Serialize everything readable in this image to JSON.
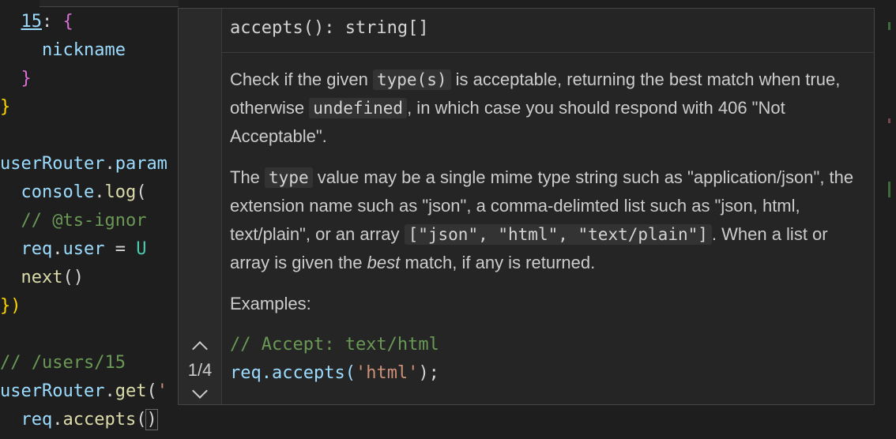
{
  "editor": {
    "lines": [
      {
        "parts": [
          [
            "  ",
            "plain"
          ],
          [
            "15",
            "ln-num"
          ],
          [
            ": ",
            "plain"
          ],
          [
            "{",
            "brace1"
          ]
        ]
      },
      {
        "parts": [
          [
            "    ",
            "plain"
          ],
          [
            "nickname",
            "var"
          ]
        ]
      },
      {
        "parts": [
          [
            "  ",
            "plain"
          ],
          [
            "}",
            "brace1"
          ]
        ]
      },
      {
        "parts": [
          [
            "}",
            "brace2"
          ]
        ]
      },
      {
        "parts": [
          [
            "",
            "plain"
          ]
        ]
      },
      {
        "parts": [
          [
            "userRouter",
            "var"
          ],
          [
            ".",
            "plain"
          ],
          [
            "param",
            "var"
          ]
        ]
      },
      {
        "parts": [
          [
            "  ",
            "plain"
          ],
          [
            "console",
            "var"
          ],
          [
            ".",
            "plain"
          ],
          [
            "log",
            "fn"
          ],
          [
            "(",
            "plain"
          ]
        ]
      },
      {
        "parts": [
          [
            "  ",
            "plain"
          ],
          [
            "// @ts-ignor",
            "cmt"
          ]
        ]
      },
      {
        "parts": [
          [
            "  ",
            "plain"
          ],
          [
            "req",
            "var"
          ],
          [
            ".",
            "plain"
          ],
          [
            "user",
            "var"
          ],
          [
            " = ",
            "plain"
          ],
          [
            "U",
            "cls"
          ]
        ]
      },
      {
        "parts": [
          [
            "  ",
            "plain"
          ],
          [
            "next",
            "fn"
          ],
          [
            "()",
            "plain"
          ]
        ]
      },
      {
        "parts": [
          [
            "}",
            "brace2"
          ],
          [
            ")",
            "brace2"
          ]
        ]
      },
      {
        "parts": [
          [
            "",
            "plain"
          ]
        ]
      },
      {
        "parts": [
          [
            "// /users/15",
            "cmt"
          ]
        ]
      },
      {
        "parts": [
          [
            "userRouter",
            "var"
          ],
          [
            ".",
            "plain"
          ],
          [
            "get",
            "fn"
          ],
          [
            "(",
            "plain"
          ],
          [
            "'",
            "str"
          ]
        ]
      },
      {
        "parts": [
          [
            "  ",
            "plain"
          ],
          [
            "req",
            "var"
          ],
          [
            ".",
            "plain"
          ],
          [
            "accepts",
            "fn"
          ],
          [
            "()",
            "plain"
          ]
        ]
      }
    ]
  },
  "hover": {
    "signature": "accepts(): string[]",
    "nav_count": "1/4",
    "p1": {
      "a": "Check if the given ",
      "code1": "type(s)",
      "b": " is acceptable, returning the best match when true, otherwise ",
      "code2": "undefined",
      "c": ", in which case you should respond with 406 \"Not Acceptable\"."
    },
    "p2": {
      "a": "The ",
      "code1": "type",
      "b": " value may be a single mime type string such as \"application/json\", the extension name such as \"json\", a comma-delimted list such as \"json, html, text/plain\", or an array ",
      "code2": "[\"json\", \"html\", \"text/plain\"]",
      "c": ". When a list or array is given the ",
      "em": "best",
      "d": " match, if any is returned."
    },
    "examples_label": "Examples:",
    "example_comment": "// Accept: text/html",
    "example_code_fn": "req.accepts(",
    "example_code_str": "'html'",
    "example_code_end": ");"
  }
}
